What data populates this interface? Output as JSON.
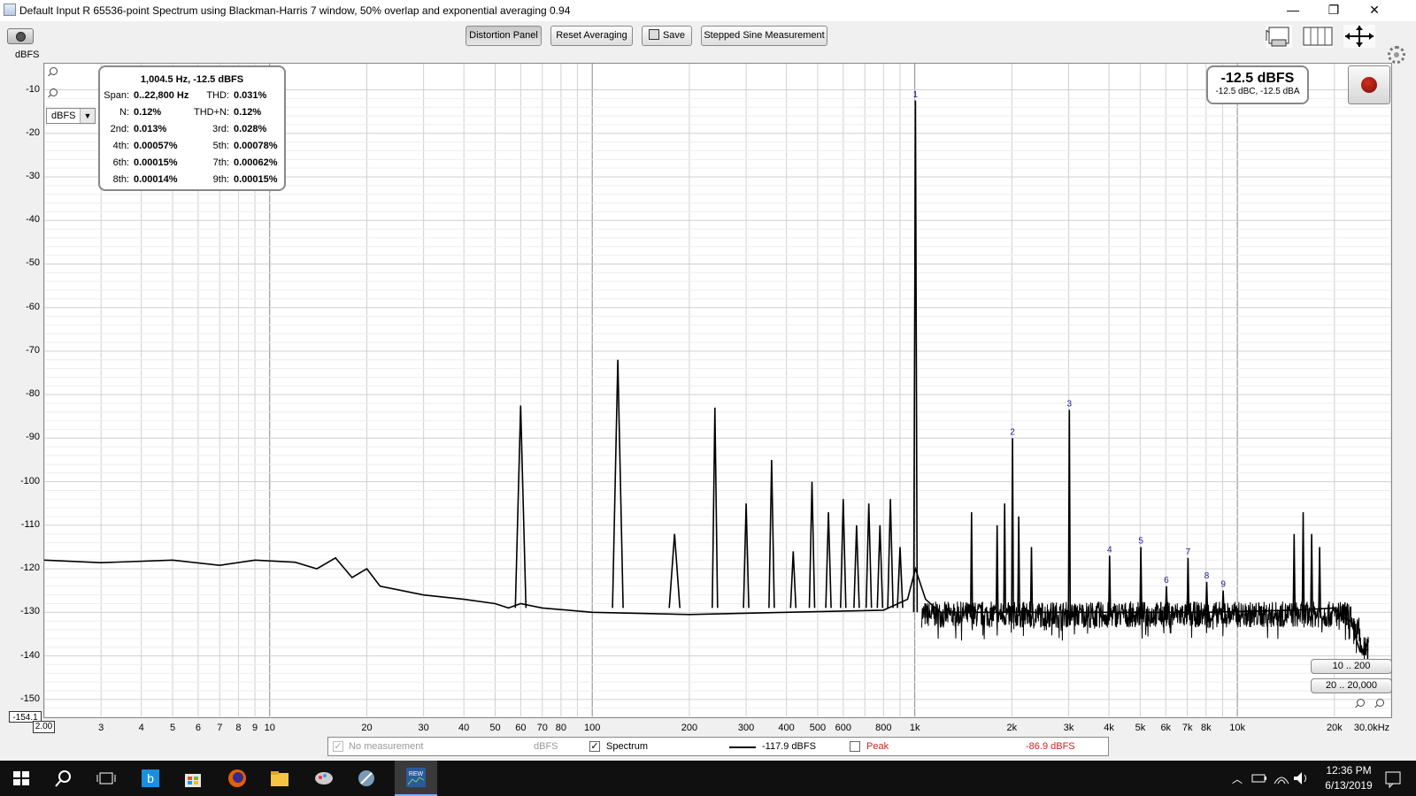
{
  "window": {
    "title": "Default Input R 65536-point Spectrum using Blackman-Harris 7 window, 50% overlap and exponential averaging 0.94",
    "minimize": "—",
    "restore": "❐",
    "close": "✕"
  },
  "toolbar": {
    "y_unit_label": "dBFS",
    "distortion_panel": "Distortion Panel",
    "reset_averaging": "Reset Averaging",
    "save": "Save",
    "stepped_sine": "Stepped Sine Measurement"
  },
  "unit_select": {
    "value": "dBFS"
  },
  "distortion_panel": {
    "header": "1,004.5 Hz, -12.5 dBFS",
    "rows": [
      {
        "k1": "Span:",
        "v1": "0..22,800 Hz",
        "k2": "THD:",
        "v2": "0.031%"
      },
      {
        "k1": "N:",
        "v1": "0.12%",
        "k2": "THD+N:",
        "v2": "0.12%"
      },
      {
        "k1": "2nd:",
        "v1": "0.013%",
        "k2": "3rd:",
        "v2": "0.028%"
      },
      {
        "k1": "4th:",
        "v1": "0.00057%",
        "k2": "5th:",
        "v2": "0.00078%"
      },
      {
        "k1": "6th:",
        "v1": "0.00015%",
        "k2": "7th:",
        "v2": "0.00062%"
      },
      {
        "k1": "8th:",
        "v1": "0.00014%",
        "k2": "9th:",
        "v2": "0.00015%"
      }
    ]
  },
  "level_meter": {
    "main": "-12.5 dBFS",
    "sub": "-12.5 dBC, -12.5 dBA"
  },
  "range_buttons": [
    "10 .. 200",
    "20 .. 20,000"
  ],
  "axes": {
    "y_min_box": "-154.1",
    "x_min_box": "2.00",
    "y_ticks": [
      "-10",
      "-20",
      "-30",
      "-40",
      "-50",
      "-60",
      "-70",
      "-80",
      "-90",
      "-100",
      "-110",
      "-120",
      "-130",
      "-140",
      "-150"
    ],
    "x_ticks": [
      "3",
      "4",
      "5",
      "6",
      "7",
      "8",
      "9",
      "10",
      "20",
      "30",
      "40",
      "50",
      "60",
      "70",
      "80",
      "100",
      "200",
      "300",
      "400",
      "500",
      "600",
      "800",
      "1k",
      "2k",
      "3k",
      "4k",
      "5k",
      "6k",
      "7k",
      "8k",
      "10k",
      "20k",
      "30.0kHz"
    ]
  },
  "legend": {
    "no_measurement": "No measurement",
    "no_measurement_unit": "dBFS",
    "spectrum_label": "Spectrum",
    "spectrum_value": "-117.9 dBFS",
    "peak_label": "Peak",
    "peak_value": "-86.9 dBFS",
    "peak_color": "#d02020"
  },
  "taskbar": {
    "time": "12:36 PM",
    "date": "6/13/2019"
  },
  "chart_data": {
    "type": "line",
    "x_scale": "log",
    "xlim": [
      2,
      30000
    ],
    "ylim": [
      -154.1,
      -4
    ],
    "ylabel": "dBFS",
    "grid": true,
    "series": [
      {
        "name": "Spectrum",
        "color": "#000000",
        "noise_floor": [
          [
            2,
            -118
          ],
          [
            3,
            -118.6
          ],
          [
            5,
            -118
          ],
          [
            7,
            -119.2
          ],
          [
            9,
            -118
          ],
          [
            12,
            -118.5
          ],
          [
            14,
            -120
          ],
          [
            16,
            -117.5
          ],
          [
            18,
            -122
          ],
          [
            20,
            -120
          ],
          [
            22,
            -124
          ],
          [
            30,
            -126
          ],
          [
            40,
            -127
          ],
          [
            50,
            -128
          ],
          [
            55,
            -129
          ],
          [
            60,
            -128
          ],
          [
            70,
            -129
          ],
          [
            100,
            -130
          ],
          [
            200,
            -130.5
          ],
          [
            400,
            -130
          ],
          [
            800,
            -129.5
          ],
          [
            950,
            -127
          ],
          [
            1004.5,
            -120
          ],
          [
            1080,
            -127
          ],
          [
            1200,
            -130
          ],
          [
            3000,
            -130
          ],
          [
            8000,
            -130
          ],
          [
            15000,
            -129.5
          ],
          [
            20000,
            -129
          ],
          [
            21000,
            -131
          ],
          [
            22500,
            -132
          ],
          [
            24000,
            -139
          ],
          [
            25500,
            -138.5
          ]
        ]
      }
    ],
    "peaks": [
      {
        "x": 60,
        "y": -82.5
      },
      {
        "x": 120,
        "y": -72
      },
      {
        "x": 180,
        "y": -112
      },
      {
        "x": 240,
        "y": -83
      },
      {
        "x": 300,
        "y": -105
      },
      {
        "x": 360,
        "y": -95
      },
      {
        "x": 420,
        "y": -116
      },
      {
        "x": 480,
        "y": -100
      },
      {
        "x": 540,
        "y": -107
      },
      {
        "x": 600,
        "y": -104
      },
      {
        "x": 660,
        "y": -110
      },
      {
        "x": 720,
        "y": -105
      },
      {
        "x": 780,
        "y": -110
      },
      {
        "x": 840,
        "y": -104
      },
      {
        "x": 900,
        "y": -115
      },
      {
        "x": 1004.5,
        "y": -12.5
      },
      {
        "x": 2009,
        "y": -90
      },
      {
        "x": 3013.5,
        "y": -83.5
      },
      {
        "x": 4018,
        "y": -117
      },
      {
        "x": 5022.5,
        "y": -115
      },
      {
        "x": 6027,
        "y": -124
      },
      {
        "x": 7031.5,
        "y": -117.5
      },
      {
        "x": 8036,
        "y": -123
      },
      {
        "x": 9040.5,
        "y": -125
      },
      {
        "x": 1500,
        "y": -107
      },
      {
        "x": 1800,
        "y": -110
      },
      {
        "x": 1900,
        "y": -105
      },
      {
        "x": 2100,
        "y": -108
      },
      {
        "x": 2300,
        "y": -115
      },
      {
        "x": 15000,
        "y": -112
      },
      {
        "x": 16000,
        "y": -107
      },
      {
        "x": 17000,
        "y": -112
      },
      {
        "x": 18000,
        "y": -115
      }
    ],
    "harmonic_markers": [
      {
        "label": "1",
        "x": 1004.5,
        "y": -12.5
      },
      {
        "label": "2",
        "x": 2009,
        "y": -90
      },
      {
        "label": "3",
        "x": 3013.5,
        "y": -83.5
      },
      {
        "label": "4",
        "x": 4018,
        "y": -117
      },
      {
        "label": "5",
        "x": 5022.5,
        "y": -115
      },
      {
        "label": "6",
        "x": 6027,
        "y": -124
      },
      {
        "label": "7",
        "x": 7031.5,
        "y": -117.5
      },
      {
        "label": "8",
        "x": 8036,
        "y": -123
      },
      {
        "label": "9",
        "x": 9040.5,
        "y": -125
      }
    ]
  }
}
